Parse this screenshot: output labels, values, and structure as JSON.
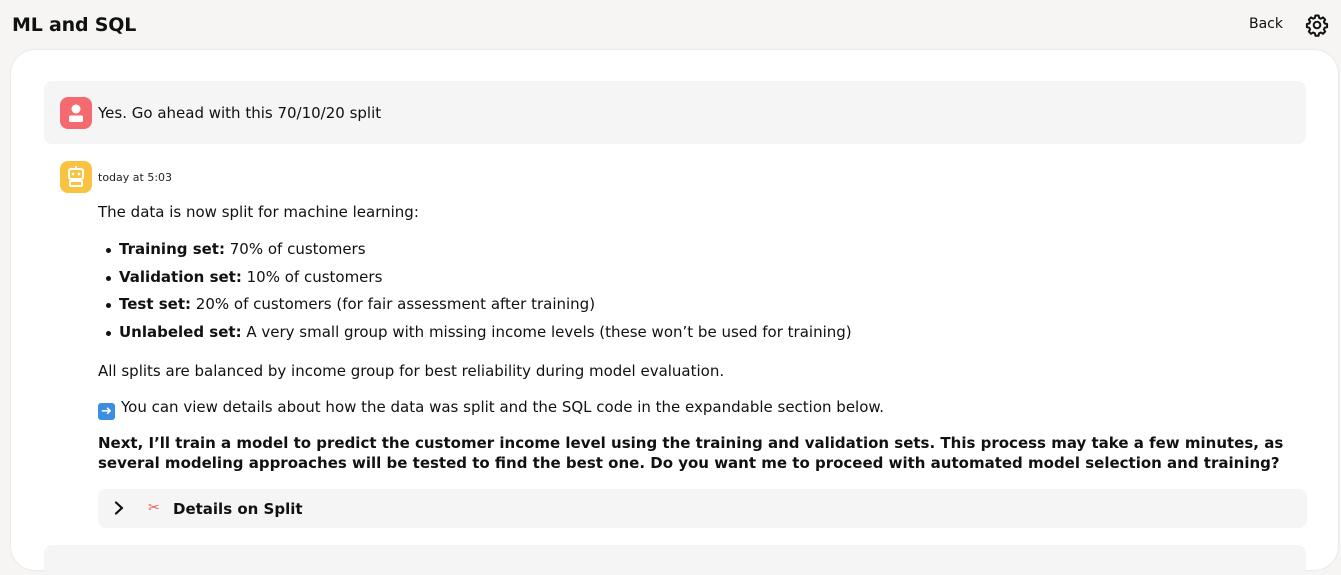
{
  "header": {
    "title": "ML and SQL",
    "back_label": "Back",
    "settings_icon": "gear-icon"
  },
  "user_message": {
    "text": "Yes. Go ahead with this 70/10/20 split",
    "avatar_icon": "user-icon",
    "avatar_color": "#f46a6f"
  },
  "assistant_message": {
    "avatar_icon": "robot-icon",
    "avatar_color": "#f7c341",
    "timestamp": "today at 5:03",
    "intro": "The data is now split for machine learning:",
    "items": [
      {
        "label": "Training set:",
        "text": " 70% of customers"
      },
      {
        "label": "Validation set:",
        "text": " 10% of customers"
      },
      {
        "label": "Test set:",
        "text": " 20% of customers (for fair assessment after training)"
      },
      {
        "label": "Unlabeled set:",
        "text": " A very small group with missing income levels (these won’t be used for training)"
      }
    ],
    "balance_note": "All splits are balanced by income group for best reliability during model evaluation.",
    "details_note": "You can view details about how the data was split and the SQL code in the expandable section below.",
    "details_note_icon": "right-arrow-icon",
    "next_steps": "Next, I’ll train a model to predict the customer income level using the training and validation sets. This process may take a few minutes, as several modeling approaches will be tested to find the best one. Do you want me to proceed with automated model selection and training?",
    "details_section": {
      "label": "Details on Split",
      "icon": "scissors-icon"
    }
  }
}
